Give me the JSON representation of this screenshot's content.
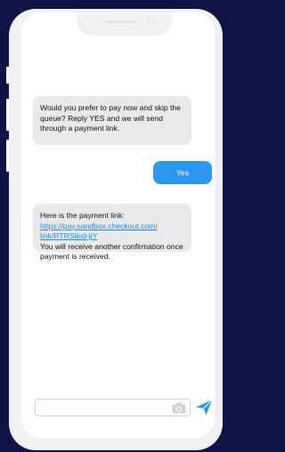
{
  "messages": {
    "incoming_1": "Would you prefer to pay now and skip the queue? Reply YES and we will send through a payment link.",
    "outgoing_1": "Yes",
    "incoming_2": {
      "intro": "Here is the payment link:",
      "link_line_1": "https://pay.sandbox.checkout.com/",
      "link_line_2": "link/RTRSilud-jjY",
      "outro": "You will receive another confirmation once payment is received."
    }
  },
  "composer": {
    "placeholder": "",
    "camera_icon": "camera-icon",
    "send_icon": "send-icon"
  },
  "colors": {
    "background": "#0f1445",
    "phone_frame": "#f1f1f3",
    "incoming_bubble": "#e9e9eb",
    "outgoing_bubble": "#2c97f0",
    "link": "#1e88e5",
    "send_icon": "#2c97f0"
  }
}
